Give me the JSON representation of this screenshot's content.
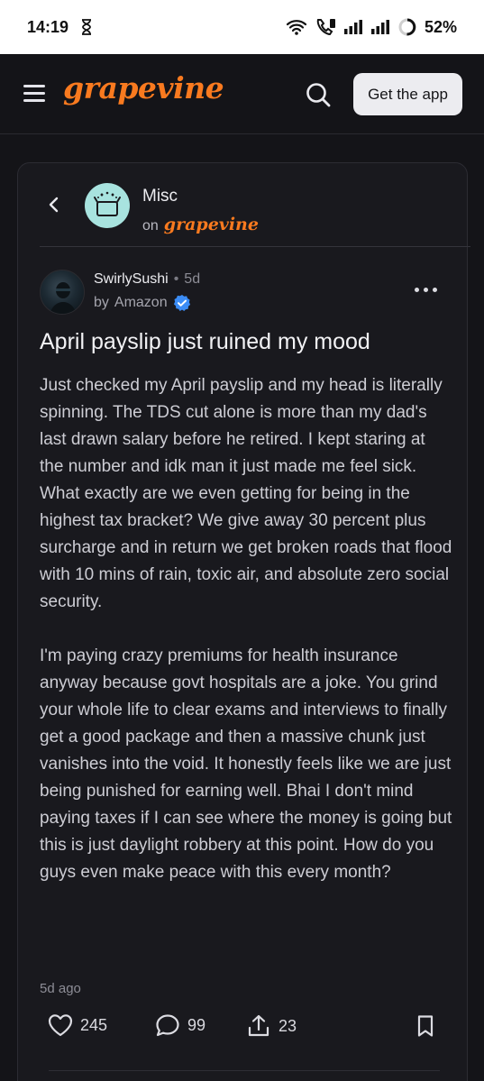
{
  "status_bar": {
    "time": "14:19",
    "battery_percent": "52%",
    "icons": [
      "hourglass-icon",
      "wifi-icon",
      "volte-call-icon",
      "signal-icon",
      "signal-icon",
      "battery-ring-icon"
    ]
  },
  "nav": {
    "logo_text": "grapevine",
    "get_app_label": "Get the app",
    "icons": [
      "menu-icon",
      "search-icon"
    ]
  },
  "community": {
    "name": "Misc",
    "on_label": "on",
    "platform": "grapevine"
  },
  "post": {
    "author": "SwirlySushi",
    "separator": "•",
    "age": "5d",
    "by_label": "by",
    "company": "Amazon",
    "title": "April payslip just ruined my mood",
    "paragraphs": [
      "Just checked my April payslip and my head is literally spinning. The TDS cut alone is more than my dad's last drawn salary before he retired. I kept staring at the number and idk man it just made me feel sick. What exactly are we even getting for being in the highest tax bracket? We give away 30 percent plus surcharge and in return we get broken roads that flood with 10 mins of rain, toxic air, and absolute zero social security.",
      "I'm paying crazy premiums for health insurance anyway because govt hospitals are a joke. You grind your whole life to clear exams and interviews to finally get a good package and then a massive chunk just vanishes into the void. It honestly feels like we are just being punished for earning well. Bhai I don't mind paying taxes if I can see where the money is going but this is just daylight robbery at this point. How do you guys even make peace with this every month?"
    ],
    "posted_ago": "5d ago",
    "likes": "245",
    "comments": "99",
    "shares": "23"
  },
  "colors": {
    "brand": "#f97a1f",
    "background": "#141418",
    "card": "#19191e",
    "verified": "#3b8cf5"
  }
}
